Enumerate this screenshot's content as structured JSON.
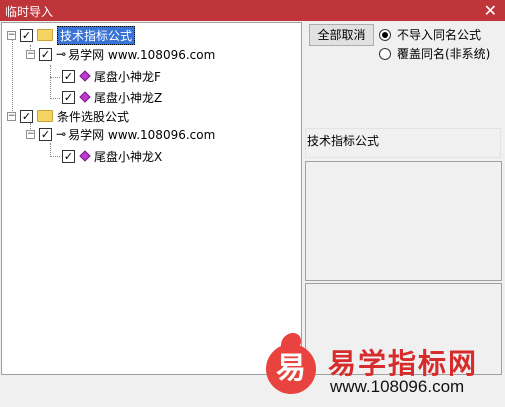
{
  "window": {
    "title": "临时导入",
    "close_glyph": "✕"
  },
  "tree": {
    "groups": [
      {
        "label": "技术指标公式",
        "selected": true,
        "checked": true,
        "expander": "−",
        "source": {
          "label": "易学网 www.108096.com",
          "expander": "−",
          "checked": true
        },
        "items": [
          {
            "label": "尾盘小神龙F",
            "checked": true
          },
          {
            "label": "尾盘小神龙Z",
            "checked": true
          }
        ]
      },
      {
        "label": "条件选股公式",
        "selected": false,
        "checked": true,
        "expander": "−",
        "source": {
          "label": "易学网 www.108096.com",
          "expander": "−",
          "checked": true
        },
        "items": [
          {
            "label": "尾盘小神龙X",
            "checked": true
          }
        ]
      }
    ]
  },
  "controls": {
    "deselect_all_label": "全部取消",
    "radio_no_import": {
      "label": "不导入同名公式",
      "checked": true
    },
    "radio_overwrite": {
      "label": "覆盖同名(非系统)",
      "checked": false
    }
  },
  "info": {
    "category_label": "技术指标公式"
  },
  "watermark": {
    "logo_char": "易",
    "title": "易学指标网",
    "url": "www.108096.com",
    "color": "#d62c2c"
  },
  "icons": {
    "folder": "folder-icon",
    "key": "key-icon",
    "formula": "formula-diamond-icon",
    "check": "✓"
  }
}
